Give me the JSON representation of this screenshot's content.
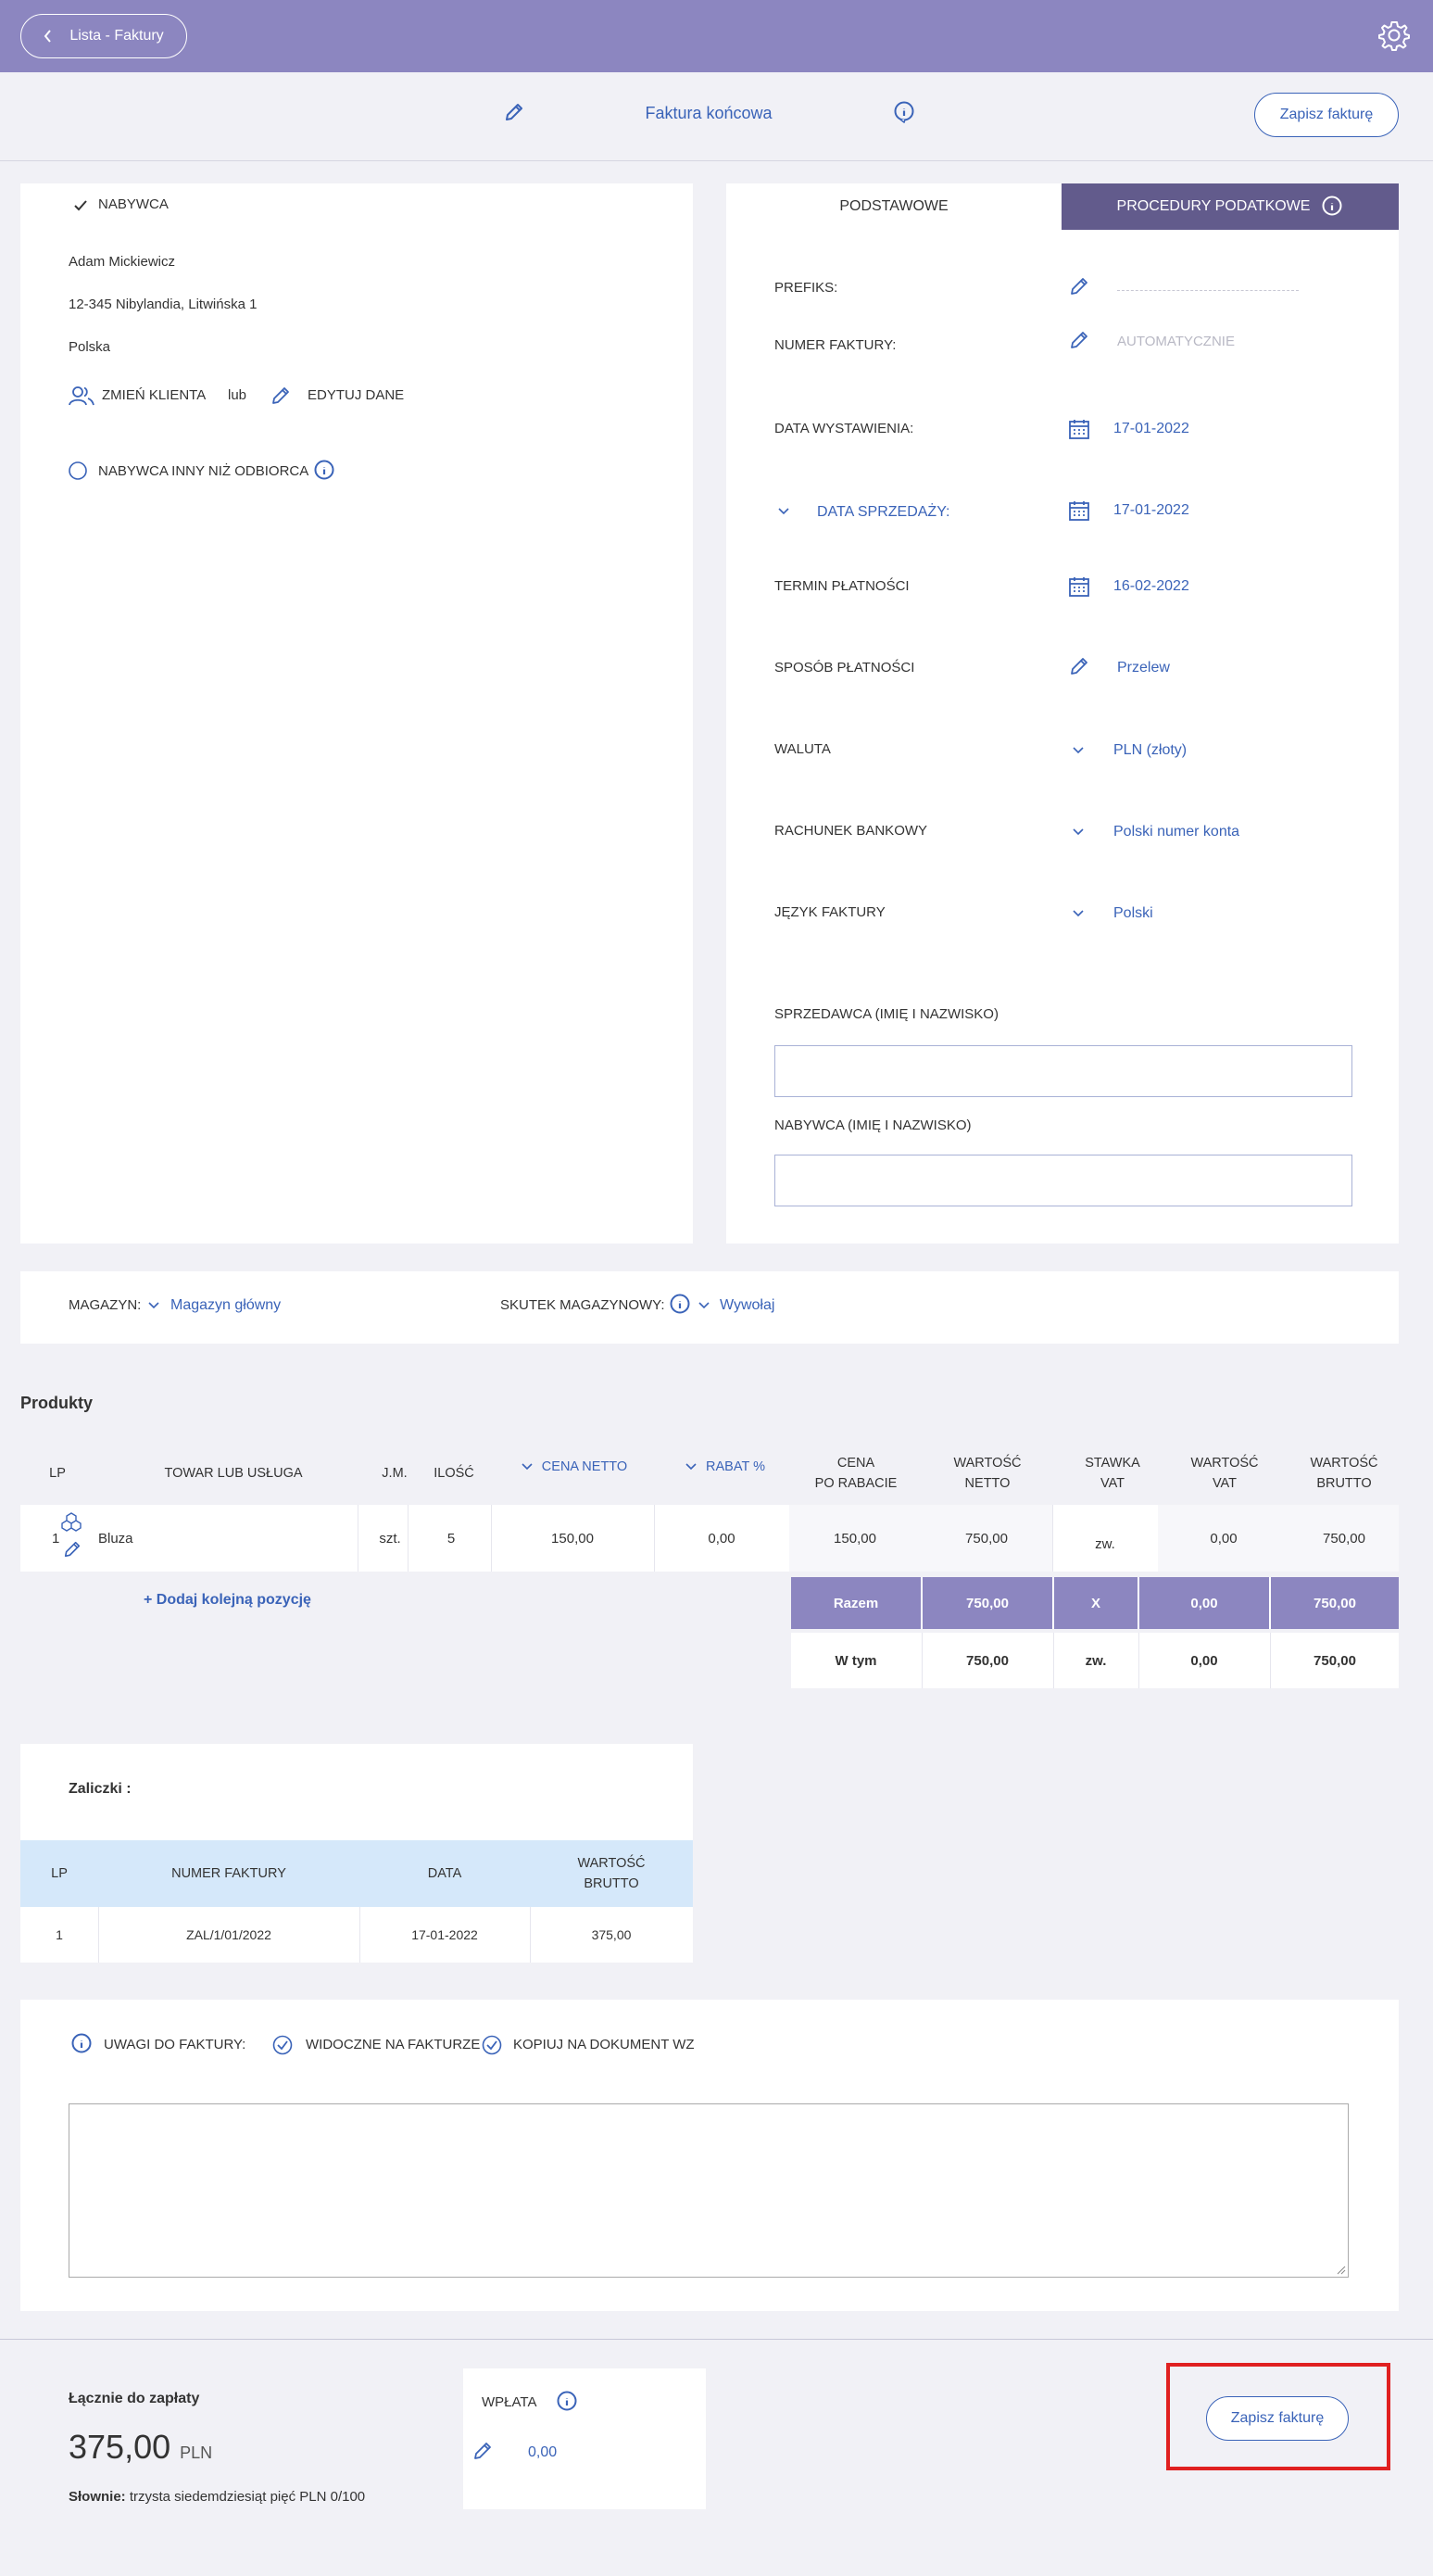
{
  "topbar": {
    "back_label": "Lista - Faktury"
  },
  "header": {
    "title": "Faktura końcowa",
    "save_label": "Zapisz fakturę"
  },
  "buyer": {
    "section_label": "NABYWCA",
    "name": "Adam Mickiewicz",
    "address": "12-345 Nibylandia, Litwińska 1",
    "country": "Polska",
    "change_client": "ZMIEŃ KLIENTA",
    "or": "lub",
    "edit_data": "EDYTUJ DANE",
    "other_recipient": "NABYWCA INNY NIŻ ODBIORCA"
  },
  "tabs": {
    "basic": "PODSTAWOWE",
    "tax": "PROCEDURY PODATKOWE"
  },
  "form": {
    "prefix_label": "PREFIKS:",
    "number_label": "NUMER FAKTURY:",
    "number_value": "AUTOMATYCZNIE",
    "issue_date_label": "DATA WYSTAWIENIA:",
    "issue_date": "17-01-2022",
    "sale_date_label": "DATA SPRZEDAŻY:",
    "sale_date": "17-01-2022",
    "due_label": "TERMIN PŁATNOŚCI",
    "due_date": "16-02-2022",
    "payment_label": "SPOSÓB PŁATNOŚCI",
    "payment_value": "Przelew",
    "currency_label": "WALUTA",
    "currency_value": "PLN (złoty)",
    "bank_label": "RACHUNEK BANKOWY",
    "bank_value": "Polski numer konta",
    "lang_label": "JĘZYK FAKTURY",
    "lang_value": "Polski",
    "seller_name_label": "SPRZEDAWCA (IMIĘ I NAZWISKO)",
    "buyer_name_label": "NABYWCA (IMIĘ I NAZWISKO)"
  },
  "warehouse": {
    "label": "MAGAZYN:",
    "value": "Magazyn główny",
    "effect_label": "SKUTEK MAGAZYNOWY:",
    "effect_value": "Wywołaj"
  },
  "products": {
    "title": "Produkty",
    "headers": [
      "LP",
      "TOWAR LUB USŁUGA",
      "J.M.",
      "ILOŚĆ",
      "CENA NETTO",
      "RABAT %",
      "CENA\nPO RABACIE",
      "WARTOŚĆ\nNETTO",
      "STAWKA\nVAT",
      "WARTOŚĆ\nVAT",
      "WARTOŚĆ\nBRUTTO"
    ],
    "row": {
      "lp": "1",
      "name": "Bluza",
      "unit": "szt.",
      "qty": "5",
      "net_price": "150,00",
      "discount": "0,00",
      "price_after": "150,00",
      "net_value": "750,00",
      "vat_rate": "zw.",
      "vat_value": "0,00",
      "gross_value": "750,00"
    },
    "add_label": "+ Dodaj kolejną pozycję",
    "total": {
      "label": "Razem",
      "net": "750,00",
      "rate": "X",
      "vat": "0,00",
      "gross": "750,00"
    },
    "incl": {
      "label": "W tym",
      "net": "750,00",
      "rate": "zw.",
      "vat": "0,00",
      "gross": "750,00"
    }
  },
  "advances": {
    "title": "Zaliczki :",
    "headers": [
      "LP",
      "NUMER FAKTURY",
      "DATA",
      "WARTOŚĆ\nBRUTTO"
    ],
    "row": {
      "lp": "1",
      "number": "ZAL/1/01/2022",
      "date": "17-01-2022",
      "gross": "375,00"
    }
  },
  "notes": {
    "label": "UWAGI DO FAKTURY:",
    "visible": "WIDOCZNE NA FAKTURZE",
    "copy": "KOPIUJ NA DOKUMENT WZ"
  },
  "footer": {
    "total_label": "Łącznie do zapłaty",
    "total_value": "375,00",
    "currency": "PLN",
    "words_label": "Słownie:",
    "words_value": "trzysta siedemdziesiąt pięć PLN 0/100",
    "payment_label": "WPŁATA",
    "payment_value": "0,00",
    "save_label": "Zapisz fakturę"
  },
  "colors": {
    "purple": "#8c86c0",
    "dark_purple": "#625b8c",
    "blue": "#3a63b8",
    "highlight": "#e02020"
  }
}
